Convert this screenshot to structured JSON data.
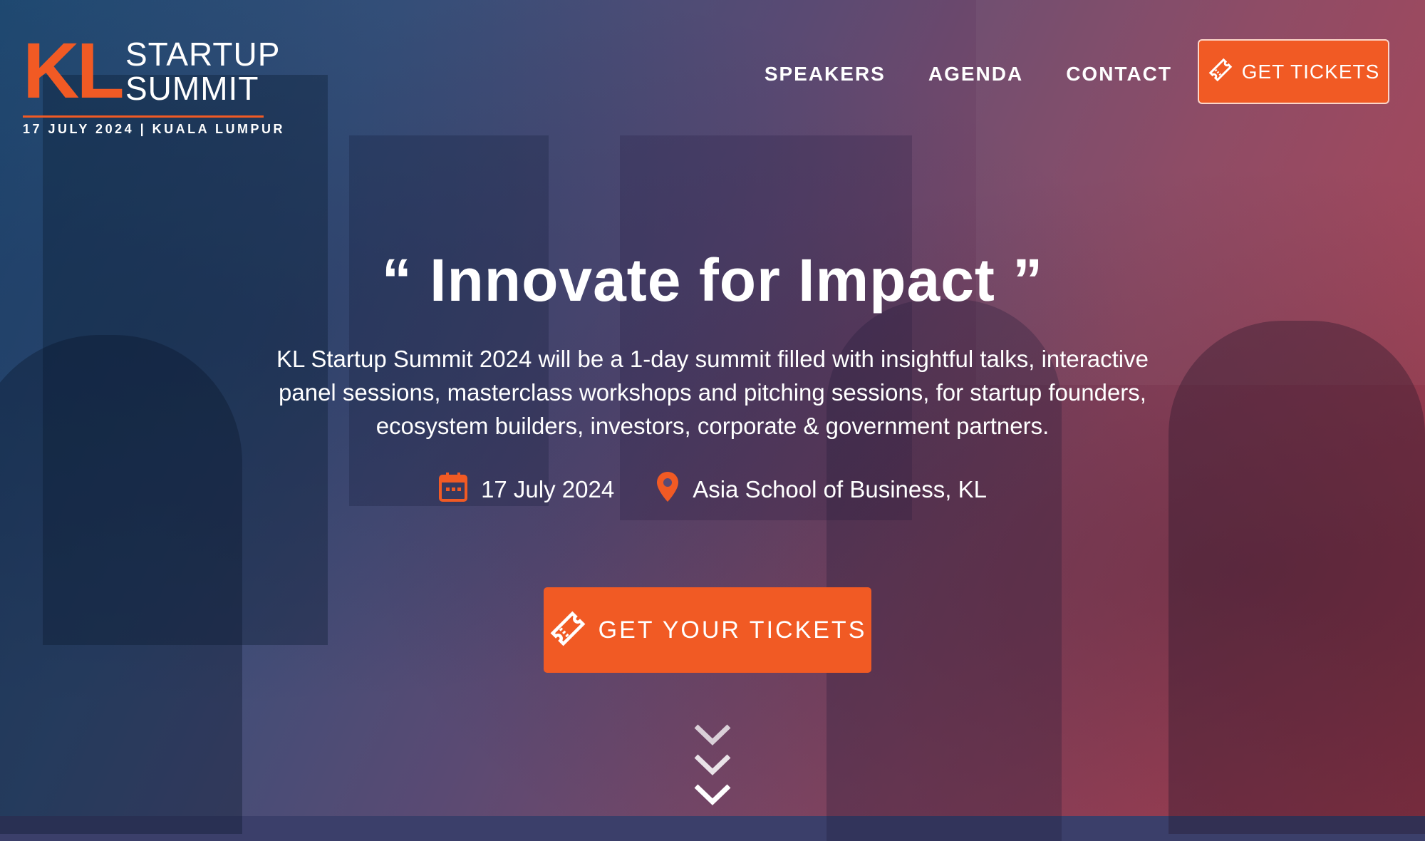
{
  "brand": {
    "logo_letters": "KL",
    "logo_line1": "STARTUP",
    "logo_line2": "SUMMIT",
    "tagline": "17 JULY 2024 | KUALA LUMPUR",
    "accent_color": "#f15a24"
  },
  "nav": {
    "links": [
      "SPEAKERS",
      "AGENDA",
      "CONTACT"
    ],
    "cta_label": "GET TICKETS",
    "cta_icon": "ticket-icon"
  },
  "hero": {
    "headline": "“ Innovate for Impact ”",
    "description": "KL Startup Summit 2024 will be a 1-day summit filled with insightful talks, interactive panel sessions, masterclass workshops and pitching sessions, for startup founders, ecosystem builders, investors, corporate & government partners.",
    "date": "17 July 2024",
    "date_icon": "calendar-icon",
    "location": "Asia School of Business, KL",
    "location_icon": "map-pin-icon",
    "cta_label": "GET YOUR TICKETS",
    "scroll_icon": "chevrons-down-icon"
  }
}
